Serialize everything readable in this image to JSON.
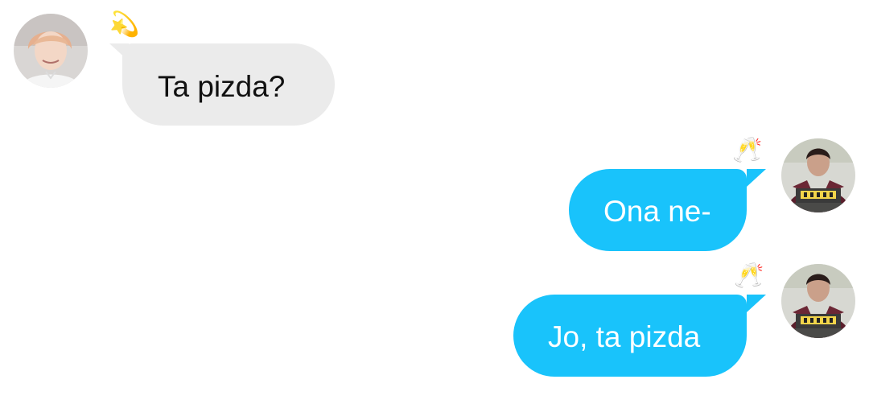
{
  "conversation": {
    "messages": [
      {
        "side": "left",
        "text": "Ta pizda?",
        "reaction_emoji": "💫",
        "avatar": "user-avatar-photo"
      },
      {
        "side": "right",
        "text": "Ona ne-",
        "reaction_emoji": "🥂",
        "avatar": "user-avatar-photo"
      },
      {
        "side": "right",
        "text": "Jo, ta pizda",
        "reaction_emoji": "🥂",
        "avatar": "user-avatar-photo"
      }
    ]
  },
  "colors": {
    "incoming_bubble": "#ebebeb",
    "outgoing_bubble": "#19c3fb",
    "incoming_text": "#111111",
    "outgoing_text": "#ffffff"
  }
}
